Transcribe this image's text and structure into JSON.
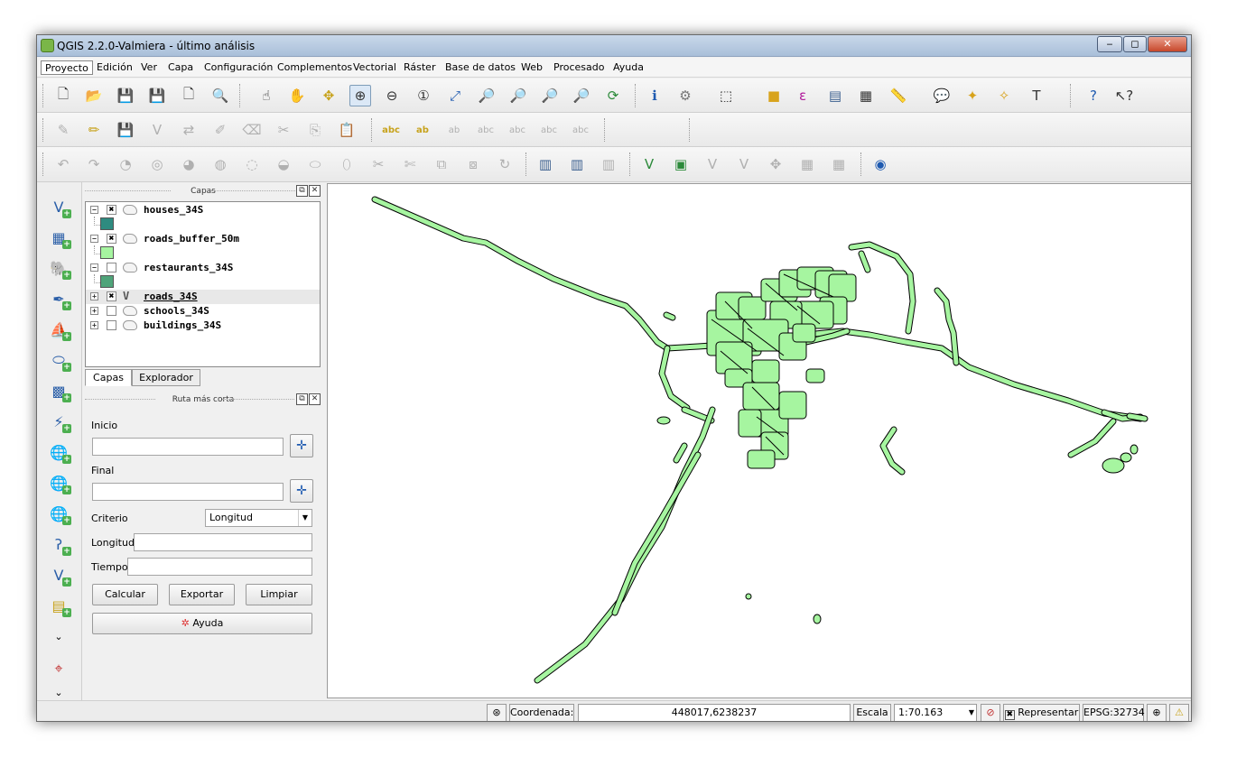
{
  "window": {
    "title": "QGIS 2.2.0-Valmiera - último análisis",
    "minimize": "‒",
    "maximize": "◻",
    "close": "✕"
  },
  "menubar": [
    "Proyecto",
    "Edición",
    "Ver",
    "Capa",
    "Configuración",
    "Complementos",
    "Vectorial",
    "Ráster",
    "Base de datos",
    "Web",
    "Procesado",
    "Ayuda"
  ],
  "layers_panel": {
    "title": "Capas",
    "layers": [
      {
        "name": "houses_34S",
        "checked": true,
        "expanded": true,
        "swatch": "#2e8b80"
      },
      {
        "name": "roads_buffer_50m",
        "checked": true,
        "expanded": true,
        "swatch": "#a6f5a0"
      },
      {
        "name": "restaurants_34S",
        "checked": false,
        "expanded": true,
        "swatch": "#4fa47a"
      },
      {
        "name": "roads_34S",
        "checked": true,
        "expanded": false
      },
      {
        "name": "schools_34S",
        "checked": false,
        "expanded": false
      },
      {
        "name": "buildings_34S",
        "checked": false,
        "expanded": false
      }
    ],
    "tabs": [
      "Capas",
      "Explorador"
    ]
  },
  "route_panel": {
    "title": "Ruta más corta",
    "start_label": "Inicio",
    "start_value": "",
    "end_label": "Final",
    "end_value": "",
    "criterion_label": "Criterio",
    "criterion_value": "Longitud",
    "length_label": "Longitud",
    "length_value": "",
    "time_label": "Tiempo",
    "time_value": "",
    "calc_button": "Calcular",
    "export_button": "Exportar",
    "clear_button": "Limpiar",
    "help_button": "Ayuda"
  },
  "statusbar": {
    "coord_label": "Coordenada:",
    "coord_value": "448017,6238237",
    "scale_label": "Escala",
    "scale_value": "1:70.163",
    "render_label": "Representar",
    "crs": "EPSG:32734"
  },
  "colors": {
    "feature_fill": "#a6f5a0",
    "feature_outline": "#000000"
  }
}
